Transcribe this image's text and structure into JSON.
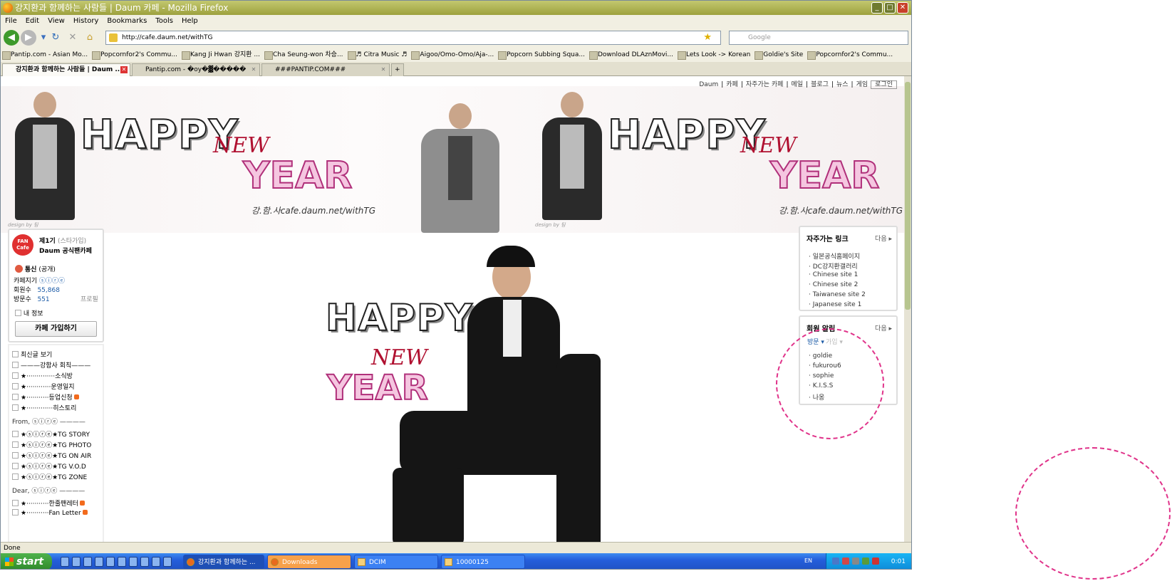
{
  "window": {
    "title": "강지환과 함께하는 사람들 | Daum 카페 - Mozilla Firefox"
  },
  "menubar": [
    "File",
    "Edit",
    "View",
    "History",
    "Bookmarks",
    "Tools",
    "Help"
  ],
  "navbar": {
    "url": "http://cafe.daum.net/withTG",
    "search_placeholder": "Google"
  },
  "bookmarks": [
    "Pantip.com - Asian Mo...",
    "Popcornfor2's Commu...",
    "Kang Ji Hwan 강지환 ...",
    "Cha Seung-won 차승...",
    "♬ Citra Music ♬",
    "Aigoo/Omo-Omo/Aja-...",
    "Popcorn Subbing Squa...",
    "Download DLAznMovi...",
    "Lets Look -> Korean",
    "Goldie's Site",
    "Popcornfor2's Commu..."
  ],
  "tabs": [
    "강지환과 함께하는 사람들 | Daum ...",
    "Pantip.com - �oy�▓�����",
    "###PANTIP.COM###"
  ],
  "topnav": [
    "Daum",
    "카페",
    "자주가는 카페",
    "메일",
    "블로그",
    "뉴스",
    "게임",
    "로그인"
  ],
  "banner": {
    "happy": "HAPPY",
    "new": "NEW",
    "year": "YEAR",
    "cafe": "강.함.사cafe.daum.net/withTG",
    "design": "design by 팀"
  },
  "left_panel": {
    "badge": "FAN Cafe",
    "level": "제1기",
    "level_note": "(스타가입)",
    "name": "Daum 공식팬카페",
    "status": "통신",
    "status_note": "(공개)",
    "keeper_label": "카페지기",
    "keeper_value": "ⓢⓘⓡⓔ",
    "members_label": "회원수",
    "members_value": "55,868",
    "visits_label": "방문수",
    "visits_value": "551",
    "profile_link": "프로필",
    "my_info": "내 정보",
    "join_button": "카페 가입하기"
  },
  "menu": [
    "최신글 보기",
    "———강함사 회칙———",
    "★··············소식방",
    "★············운영일지",
    "★···········등업신청",
    "★·············히스토리",
    "From, ⓢⓘⓡⓔ ————",
    "★ⓢⓘⓡⓔ★TG STORY",
    "★ⓢⓘⓡⓔ★TG PHOTO",
    "★ⓢⓘⓡⓔ★TG ON AIR",
    "★ⓢⓘⓡⓔ★TG    V.O.D",
    "★ⓢⓘⓡⓔ★TG    ZONE",
    "Dear, ⓢⓘⓡⓔ ————",
    "★···········한줄팬레터",
    "★···········Fan Letter"
  ],
  "main_image": {
    "happy": "HAPPY",
    "new": "NEW",
    "year": "YEAR"
  },
  "links_box": {
    "title": "자주가는 링크",
    "more": "다음",
    "items": [
      "일본공식홈페이지",
      "DC강지환갤러리",
      "Chinese site 1",
      "Chinese site 2",
      "Taiwanese site 2",
      "Japanese site 1"
    ]
  },
  "members_box": {
    "title": "회원 알림",
    "more": "다음",
    "tab_visit": "방문",
    "tab_join": "가입",
    "items": [
      "goldie",
      "fukurou6",
      "sophie",
      "K.I.S.S",
      "나옹"
    ]
  },
  "statusbar": {
    "text": "Done"
  },
  "taskbar": {
    "start": "start",
    "items": [
      "강지환과 함께하는 ...",
      "Downloads",
      "DCIM",
      "10000125"
    ],
    "lang": "EN",
    "clock": "0:01"
  },
  "colors": {
    "accent": "#e0338a",
    "titlebar": "#9da13e",
    "taskbar": "#245edb"
  }
}
